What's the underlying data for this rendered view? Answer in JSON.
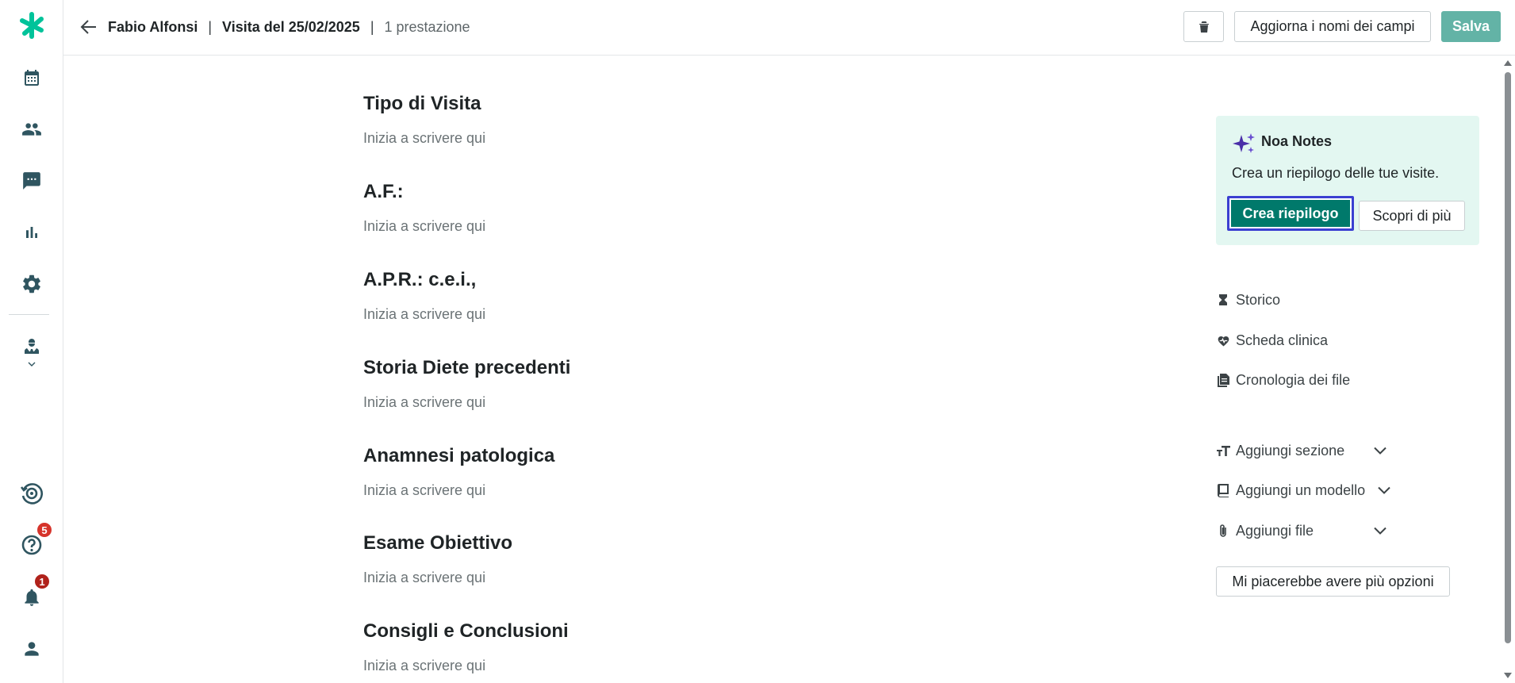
{
  "header": {
    "patient_name": "Fabio Alfonsi",
    "separator": "|",
    "visit": "Visita del 25/02/2025",
    "services": "1 prestazione",
    "rename_fields_label": "Aggiorna i nomi dei campi",
    "save_label": "Salva"
  },
  "sidebar": {
    "items": [
      {
        "name": "logo",
        "icon": "brand-logo-icon"
      },
      {
        "name": "calendar",
        "icon": "calendar-icon"
      },
      {
        "name": "patients",
        "icon": "people-icon"
      },
      {
        "name": "messages",
        "icon": "chat-icon"
      },
      {
        "name": "statistics",
        "icon": "bar-chart-icon"
      },
      {
        "name": "settings",
        "icon": "gear-icon"
      },
      {
        "name": "doctor-profile",
        "icon": "doctor-icon"
      },
      {
        "name": "activity",
        "icon": "history-target-icon"
      },
      {
        "name": "help",
        "icon": "help-icon"
      },
      {
        "name": "notifications",
        "icon": "bell-icon"
      },
      {
        "name": "account",
        "icon": "user-icon"
      }
    ],
    "help_badge": "5",
    "notifications_badge": "1",
    "accent": "#00c39a"
  },
  "form": {
    "sections": [
      {
        "title": "Tipo di Visita",
        "placeholder": "Inizia a scrivere qui"
      },
      {
        "title": "A.F.:",
        "placeholder": "Inizia a scrivere qui"
      },
      {
        "title": "A.P.R.: c.e.i.,",
        "placeholder": "Inizia a scrivere qui"
      },
      {
        "title": "Storia Diete precedenti",
        "placeholder": "Inizia a scrivere qui"
      },
      {
        "title": "Anamnesi patologica",
        "placeholder": "Inizia a scrivere qui"
      },
      {
        "title": "Esame Obiettivo",
        "placeholder": "Inizia a scrivere qui"
      },
      {
        "title": "Consigli e Conclusioni",
        "placeholder": "Inizia a scrivere qui"
      }
    ]
  },
  "noa": {
    "title": "Noa Notes",
    "description": "Crea un riepilogo delle tue visite.",
    "create_label": "Crea riepilogo",
    "learn_more_label": "Scopri di più"
  },
  "side_links": {
    "history": "Storico",
    "clinical_record": "Scheda clinica",
    "file_history": "Cronologia dei file"
  },
  "add_menu": {
    "add_section": "Aggiungi sezione",
    "add_template": "Aggiungi un modello",
    "add_file": "Aggiungi file"
  },
  "more_options_label": "Mi piacerebbe avere più opzioni",
  "colors": {
    "primary": "#00796b",
    "save_disabled": "#63b3a6",
    "noa_background": "#e3f7f1",
    "focus_ring": "#3b3fd1",
    "badge": "#d6342b"
  }
}
